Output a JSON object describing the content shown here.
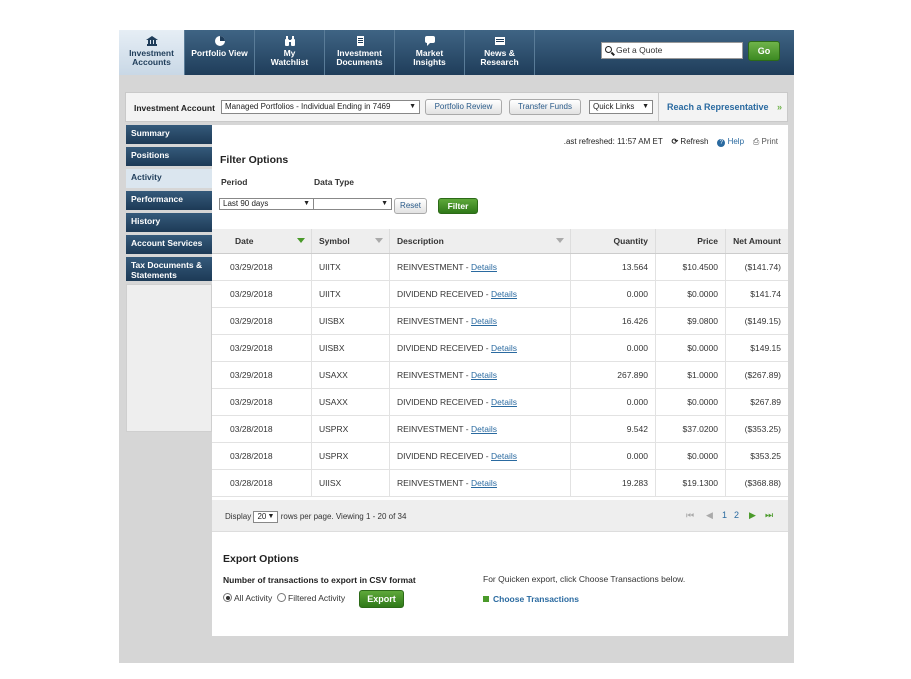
{
  "nav": {
    "tabs": [
      {
        "label1": "Investment",
        "label2": "Accounts",
        "icon": "bank-icon"
      },
      {
        "label1": "Portfolio View",
        "label2": "",
        "icon": "pie-chart-icon"
      },
      {
        "label1": "My",
        "label2": "Watchlist",
        "icon": "binoculars-icon"
      },
      {
        "label1": "Investment",
        "label2": "Documents",
        "icon": "document-icon"
      },
      {
        "label1": "Market",
        "label2": "Insights",
        "icon": "speech-bubble-icon"
      },
      {
        "label1": "News &",
        "label2": "Research",
        "icon": "newspaper-icon"
      }
    ],
    "quote_placeholder": "Get a Quote",
    "go_label": "Go"
  },
  "account_bar": {
    "label": "Investment Account",
    "selected_account": "Managed Portfolios - Individual Ending in 7469",
    "portfolio_review": "Portfolio Review",
    "transfer_funds": "Transfer Funds",
    "quick_links": "Quick Links",
    "reach_rep": "Reach a Representative",
    "reach_chevron": "»"
  },
  "sidebar": {
    "items": [
      {
        "label": "Summary"
      },
      {
        "label": "Positions"
      },
      {
        "label": "Activity"
      },
      {
        "label": "Performance"
      },
      {
        "label": "History"
      },
      {
        "label": "Account Services"
      },
      {
        "label": "Tax Documents & Statements"
      }
    ]
  },
  "toolbar": {
    "last_refreshed": ".ast refreshed: 11:57 AM ET",
    "refresh": "Refresh",
    "help": "Help",
    "print": "Print"
  },
  "filter": {
    "title": "Filter Options",
    "period_label": "Period",
    "data_type_label": "Data Type",
    "period_value": "Last 90 days",
    "data_type_value": "",
    "reset": "Reset",
    "filter": "Filter"
  },
  "table": {
    "headers": [
      "Date",
      "Symbol",
      "Description",
      "Quantity",
      "Price",
      "Net Amount"
    ],
    "rows": [
      {
        "date": "03/29/2018",
        "symbol": "UIITX",
        "desc": "REINVESTMENT - ",
        "qty": "13.564",
        "price": "$10.4500",
        "net": "($141.74)"
      },
      {
        "date": "03/29/2018",
        "symbol": "UIITX",
        "desc": "DIVIDEND RECEIVED - ",
        "qty": "0.000",
        "price": "$0.0000",
        "net": "$141.74"
      },
      {
        "date": "03/29/2018",
        "symbol": "UISBX",
        "desc": "REINVESTMENT - ",
        "qty": "16.426",
        "price": "$9.0800",
        "net": "($149.15)"
      },
      {
        "date": "03/29/2018",
        "symbol": "UISBX",
        "desc": "DIVIDEND RECEIVED - ",
        "qty": "0.000",
        "price": "$0.0000",
        "net": "$149.15"
      },
      {
        "date": "03/29/2018",
        "symbol": "USAXX",
        "desc": "REINVESTMENT - ",
        "qty": "267.890",
        "price": "$1.0000",
        "net": "($267.89)"
      },
      {
        "date": "03/29/2018",
        "symbol": "USAXX",
        "desc": "DIVIDEND RECEIVED - ",
        "qty": "0.000",
        "price": "$0.0000",
        "net": "$267.89"
      },
      {
        "date": "03/28/2018",
        "symbol": "USPRX",
        "desc": "REINVESTMENT - ",
        "qty": "9.542",
        "price": "$37.0200",
        "net": "($353.25)"
      },
      {
        "date": "03/28/2018",
        "symbol": "USPRX",
        "desc": "DIVIDEND RECEIVED - ",
        "qty": "0.000",
        "price": "$0.0000",
        "net": "$353.25"
      },
      {
        "date": "03/28/2018",
        "symbol": "UIISX",
        "desc": "REINVESTMENT - ",
        "qty": "19.283",
        "price": "$19.1300",
        "net": "($368.88)"
      }
    ],
    "details_label": "Details"
  },
  "pager": {
    "display": "Display",
    "per_page": "20",
    "rows_text": "rows per page. Viewing 1 - 20 of 34",
    "page1": "1",
    "page2": "2"
  },
  "export": {
    "title": "Export Options",
    "count_label": "Number of transactions to export in CSV format",
    "all_activity": "All Activity",
    "filtered_activity": "Filtered Activity",
    "export_button": "Export",
    "quicken_note": "For Quicken export, click Choose Transactions below.",
    "choose_transactions": "Choose Transactions"
  },
  "colors": {
    "nav_dark": "#1f3d5a",
    "green": "#3c8a22",
    "negative": "#b5352e",
    "link": "#2a6aa0"
  }
}
